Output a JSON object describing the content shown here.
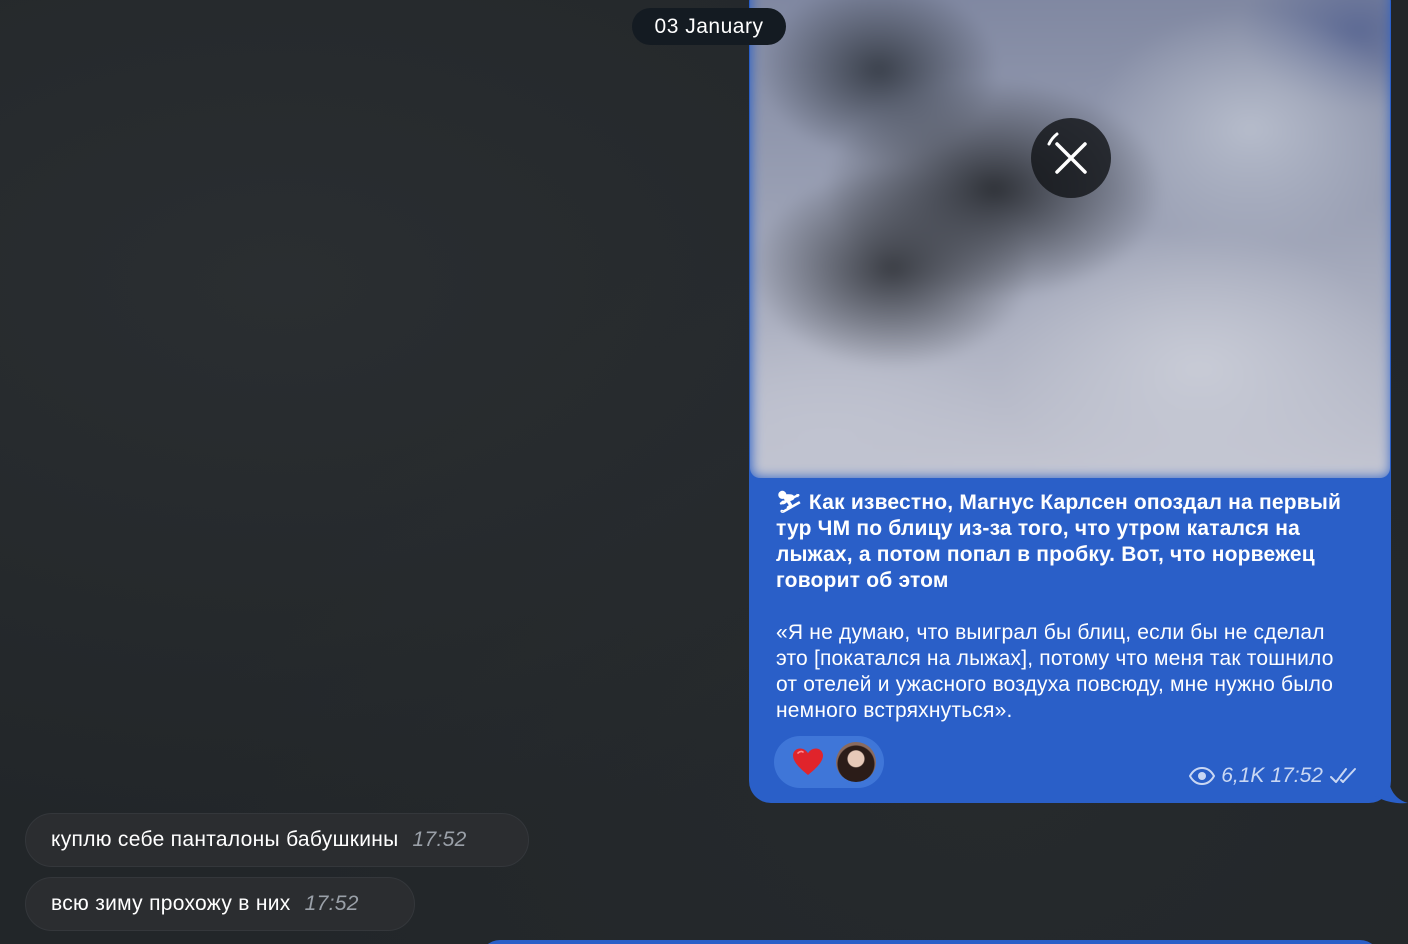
{
  "date_separator": "03 January",
  "channel_post": {
    "media_state": "loading",
    "cancel_icon": "close-icon",
    "title_emoji": "⛷",
    "title": "Как известно, Магнус Карлсен опоздал на первый тур ЧМ по блицу из-за того, что утром катался на лыжах, а потом попал в пробку. Вот, что норвежец говорит об этом",
    "quote": "«Я не думаю, что выиграл бы блиц, если бы не сделал это [покатался на лыжах], потому что меня так тошнило от отелей и ужасного воздуха повсюду, мне нужно было немного встряхнуться».",
    "reactions": [
      {
        "icon": "heart-icon",
        "color": "#e0242b"
      },
      {
        "icon": "avatar"
      }
    ],
    "views": "6,1K",
    "time": "17:52",
    "status_icon": "double-check-icon"
  },
  "messages": [
    {
      "text": "куплю себе панталоны бабушкины",
      "time": "17:52"
    },
    {
      "text": "всю зиму прохожу в них",
      "time": "17:52"
    }
  ],
  "colors": {
    "background": "#222629",
    "outgoing_bubble": "#2a5fc8",
    "incoming_bubble": "#2b2d30",
    "date_pill": "#141b22"
  }
}
